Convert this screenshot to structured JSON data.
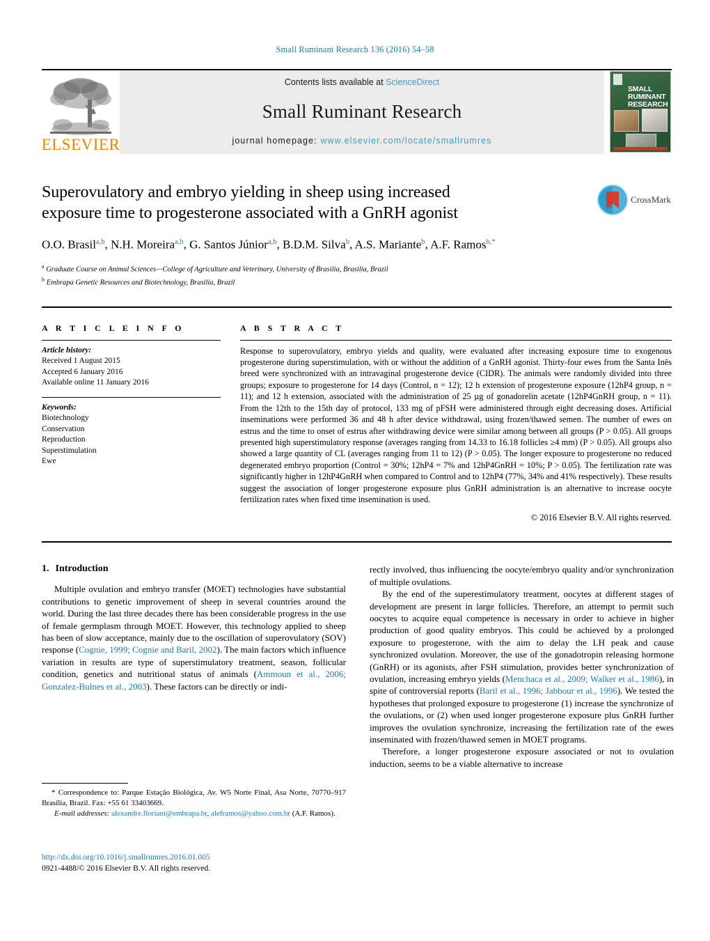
{
  "running_head": "Small Ruminant Research 136 (2016) 54–58",
  "banner": {
    "publisher_wordmark": "ELSEVIER",
    "contents_prefix": "Contents lists available at ",
    "contents_link": "ScienceDirect",
    "journal_title": "Small Ruminant Research",
    "homepage_prefix": "journal homepage: ",
    "homepage_url": "www.elsevier.com/locate/smallrumres",
    "cover_title": "SMALL RUMINANT RESEARCH"
  },
  "crossmark": {
    "label": "CrossMark"
  },
  "article": {
    "title": "Superovulatory and embryo yielding in sheep using increased exposure time to progesterone associated with a GnRH agonist",
    "authors_html": "O.O. Brasil<sup>a,b</sup>, N.H. Moreira<sup>a,b</sup>, G. Santos Júnior<sup>a,b</sup>, B.D.M. Silva<sup>b</sup>, A.S. Mariante<sup>b</sup>, A.F. Ramos<sup>b,</sup><sup>*</sup>",
    "affiliation_a": "Graduate Course on Animal Sciences—College of Agriculture and Veterinary, University of Brasilia, Brasilia, Brazil",
    "affiliation_b": "Embrapa Genetic Resources and Biotechnology, Brasilia, Brazil"
  },
  "article_info": {
    "heading": "A R T I C L E   I N F O",
    "history_label": "Article history:",
    "history": [
      "Received 1 August 2015",
      "Accepted 6 January 2016",
      "Available online 11 January 2016"
    ],
    "keywords_label": "Keywords:",
    "keywords": [
      "Biotechnology",
      "Conservation",
      "Reproduction",
      "Superstimulation",
      "Ewe"
    ]
  },
  "abstract": {
    "heading": "A B S T R A C T",
    "text": "Response to superovulatory, embryo yields and quality, were evaluated after increasing exposure time to exogenous progesterone during superstimulation, with or without the addition of a GnRH agonist. Thirty-four ewes from the Santa Inês breed were synchronized with an intravaginal progesterone device (CIDR). The animals were randomly divided into three groups; exposure to progesterone for 14 days (Control, n = 12); 12 h extension of progesterone exposure (12hP4 group, n = 11); and 12 h extension, associated with the administration of 25 µg of gonadorelin acetate (12hP4GnRH group, n = 11). From the 12th to the 15th day of protocol, 133 mg of pFSH were administered through eight decreasing doses. Artificial inseminations were performed 36 and 48 h after device withdrawal, using frozen/thawed semen. The number of ewes on estrus and the time to onset of estrus after withdrawing device were similar among between all groups (P > 0.05). All groups presented high superstimulatory response (averages ranging from 14.33 to 16.18 follicles ≥4 mm) (P > 0.05). All groups also showed a large quantity of CL (averages ranging from 11 to 12) (P > 0.05). The longer exposure to progesterone no reduced degenerated embryo proportion (Control = 30%; 12hP4 = 7% and 12hP4GnRH = 10%; P > 0.05). The fertilization rate was significantly higher in 12hP4GnRH when compared to Control and to 12hP4 (77%, 34% and 41% respectively). These results suggest the association of longer progesterone exposure plus GnRH administration is an alternative to increase oocyte fertilization rates when fixed time insemination is used.",
    "copyright": "© 2016 Elsevier B.V. All rights reserved."
  },
  "introduction": {
    "number": "1.",
    "heading": "Introduction",
    "left_para_1_a": "Multiple ovulation and embryo transfer (MOET) technologies have substantial contributions to genetic improvement of sheep in several countries around the world. During the last three decades there has been considerable progress in the use of female germplasm through MOET. However, this technology applied to sheep has been of slow acceptance, mainly due to the oscillation of superovulatory (SOV) response (",
    "cite_1": "Cognie, 1999; Cognie and Baril, 2002",
    "left_para_1_b": "). The main factors which influence variation in results are type of superstimulatory treatment, season, follicular condition, genetics and nutritional status of animals (",
    "cite_2": "Ammoun et al., 2006; Gonzalez-Bulnes et al., 2003",
    "left_para_1_c": "). These factors can be directly or indi-",
    "right_para_1_cont": "rectly involved, thus influencing the oocyte/embryo quality and/or synchronization of multiple ovulations.",
    "right_para_2_a": "By the end of the superestimulatory treatment, oocytes at different stages of development are present in large follicles. Therefore, an attempt to permit such oocytes to acquire equal competence is necessary in order to achieve in higher production of good quality embryos. This could be achieved by a prolonged exposure to progesterone, with the aim to delay the LH peak and cause synchronized ovulation. Moreover, the use of the gonadotropin releasing hormone (GnRH) or its agonists, after FSH stimulation, provides better synchronization of ovulation, increasing embryo yields (",
    "cite_3": "Menchaca et al., 2009; Walker et al., 1986",
    "right_para_2_b": "), in spite of controversial reports (",
    "cite_4": "Baril et al., 1996; Jabbour et al., 1996",
    "right_para_2_c": "). We tested the hypotheses that prolonged exposure to progesterone (1) increase the synchronize of the ovulations, or (2) when used longer progesterone exposure plus GnRH further improves the ovulation synchronize, increasing the fertilization rate of the ewes inseminated with frozen/thawed semen in MOET programs.",
    "right_para_3": "Therefore, a longer progesterone exposure associated or not to ovulation induction, seems to be a viable alternative to increase"
  },
  "footnote": {
    "star": "*",
    "correspondence": "Correspondence to: Parque Estação Biológica, Av. W5 Norte Final, Asa Norte, 70770–917 Brasília, Brazil. Fax: +55 61 33403669.",
    "email_label": "E-mail addresses:",
    "email_1": "alexandre.floriani@embrapa.br",
    "email_sep": ", ",
    "email_2": "aleframos@yahoo.com.br",
    "email_owner": "(A.F. Ramos)."
  },
  "doi_block": {
    "doi_url": "http://dx.doi.org/10.1016/j.smallrumres.2016.01.005",
    "issn_line": "0921-4488/© 2016 Elsevier B.V. All rights reserved."
  },
  "colors": {
    "link": "#1a7ba4",
    "banner_link": "#3c9cc8",
    "elsevier_orange": "#f08000",
    "banner_bg": "#ececec"
  }
}
